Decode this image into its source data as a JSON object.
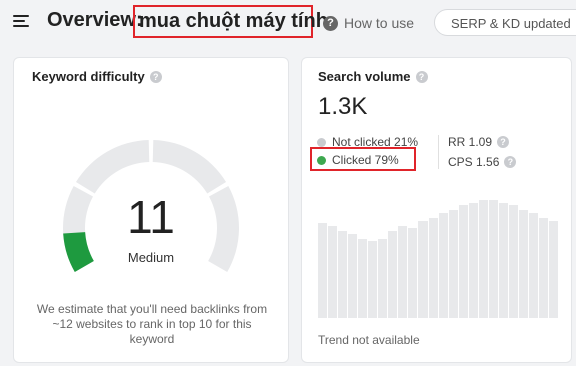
{
  "header": {
    "title_prefix": "Overview:",
    "keyword": "mua chuột máy tính",
    "help_link": "How to use",
    "serp_pill": "SERP & KD updated"
  },
  "keyword_difficulty": {
    "title": "Keyword difficulty",
    "value": "11",
    "label": "Medium",
    "note": "We estimate that you'll need backlinks from ~12 websites to rank in top 10 for this keyword",
    "score": 11,
    "max": 100
  },
  "search_volume": {
    "title": "Search volume",
    "value": "1.3K",
    "not_clicked": "Not clicked 21%",
    "clicked": "Clicked 79%",
    "rr": "RR 1.09",
    "cps": "CPS 1.56",
    "trend_note": "Trend not available",
    "trend_levels": [
      0.74,
      0.72,
      0.68,
      0.66,
      0.62,
      0.6,
      0.62,
      0.68,
      0.72,
      0.7,
      0.76,
      0.78,
      0.82,
      0.84,
      0.88,
      0.9,
      0.92,
      0.92,
      0.9,
      0.88,
      0.84,
      0.82,
      0.78,
      0.76
    ]
  },
  "colors": {
    "accent_red": "#e0242a",
    "kd_green": "#1e9a3f",
    "clicked_green": "#3ea84f",
    "not_clicked_gray": "#c9cbcf"
  }
}
